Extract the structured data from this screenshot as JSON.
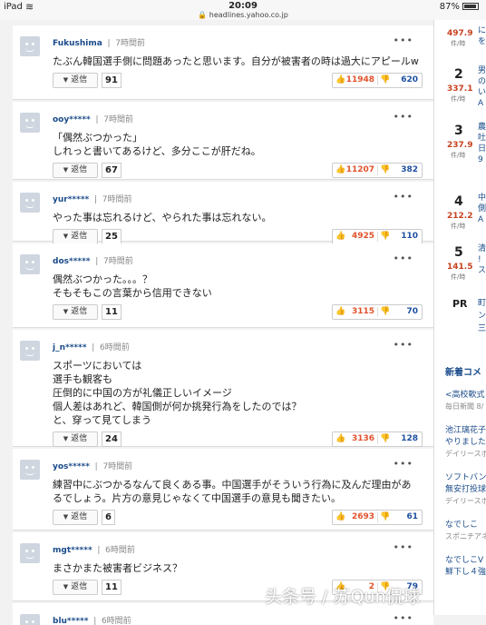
{
  "status": {
    "device": "iPad",
    "time": "20:09",
    "url": "headlines.yahoo.co.jp",
    "battery": "87%"
  },
  "comments": [
    {
      "user": "Fukushima",
      "time": "7時間前",
      "lines": [
        "たぶん韓国選手側に問題あったと思います。自分が被害者の時は過大にアピールw"
      ],
      "replies": "91",
      "up": "11948",
      "down": "620"
    },
    {
      "user": "ooy*****",
      "time": "7時間前",
      "lines": [
        "「偶然ぶつかった」",
        "しれっと書いてあるけど、多分ここが肝だね。"
      ],
      "replies": "67",
      "up": "11207",
      "down": "382"
    },
    {
      "user": "yur*****",
      "time": "7時間前",
      "lines": [
        "やった事は忘れるけど、やられた事は忘れない。"
      ],
      "replies": "25",
      "up": "4925",
      "down": "110"
    },
    {
      "user": "dos*****",
      "time": "7時間前",
      "lines": [
        "偶然ぶつかった。。。？",
        "そもそもこの言葉から信用できない"
      ],
      "replies": "11",
      "up": "3115",
      "down": "70"
    },
    {
      "user": "j_n*****",
      "time": "6時間前",
      "lines": [
        "スポーツにおいては",
        "選手も観客も",
        "圧倒的に中国の方が礼儀正しいイメージ",
        "個人差はあれど、韓国側が何か挑発行為をしたのでは？",
        "と、穿って見てしまう"
      ],
      "replies": "24",
      "up": "3136",
      "down": "128"
    },
    {
      "user": "yos*****",
      "time": "7時間前",
      "lines": [
        "練習中にぶつかるなんて良くある事。中国選手がそういう行為に及んだ理由があ",
        "るでしょう。片方の意見じゃなくて中国選手の意見も聞きたい。"
      ],
      "replies": "6",
      "up": "2693",
      "down": "61"
    },
    {
      "user": "mgt*****",
      "time": "6時間前",
      "lines": [
        "まさかまた被害者ビジネス？"
      ],
      "replies": "11",
      "up": "2",
      "down": "79"
    },
    {
      "user": "blu*****",
      "time": "6時間前",
      "lines": [],
      "replies": "",
      "up": "",
      "down": ""
    }
  ],
  "reply_label": "返信",
  "ranking": [
    {
      "num": "",
      "val": "497.9",
      "unit": "件/時",
      "title": [
        "に",
        "を"
      ]
    },
    {
      "num": "2",
      "val": "337.1",
      "unit": "件/時",
      "title": [
        "男",
        "の",
        "い",
        "A"
      ]
    },
    {
      "num": "3",
      "val": "237.9",
      "unit": "件/時",
      "title": [
        "農",
        "吐",
        "日",
        "9"
      ]
    },
    {
      "num": "4",
      "val": "212.2",
      "unit": "件/時",
      "title": [
        "中",
        "側",
        "A"
      ]
    },
    {
      "num": "5",
      "val": "141.5",
      "unit": "件/時",
      "title": [
        "清",
        "!",
        "ス"
      ]
    }
  ],
  "pr": {
    "label": "PR",
    "title": [
      "町",
      "ン",
      "三"
    ]
  },
  "side_news": {
    "heading": "新着コメ",
    "items": [
      {
        "title": [
          "<高校軟式"
        ],
        "source": "毎日新聞 8/"
      },
      {
        "title": [
          "池江璃花子",
          "やりました"
        ],
        "source": "デイリースポ"
      },
      {
        "title": [
          "ソフトバン",
          "無安打投球"
        ],
        "source": "デイリースポ"
      },
      {
        "title": [
          "なでしこ"
        ],
        "source": "スポニチアネ"
      },
      {
        "title": [
          "なでしこV",
          "鮮下し４強"
        ],
        "source": ""
      }
    ]
  },
  "watermark": "头条号 / 苏Qun侃球"
}
